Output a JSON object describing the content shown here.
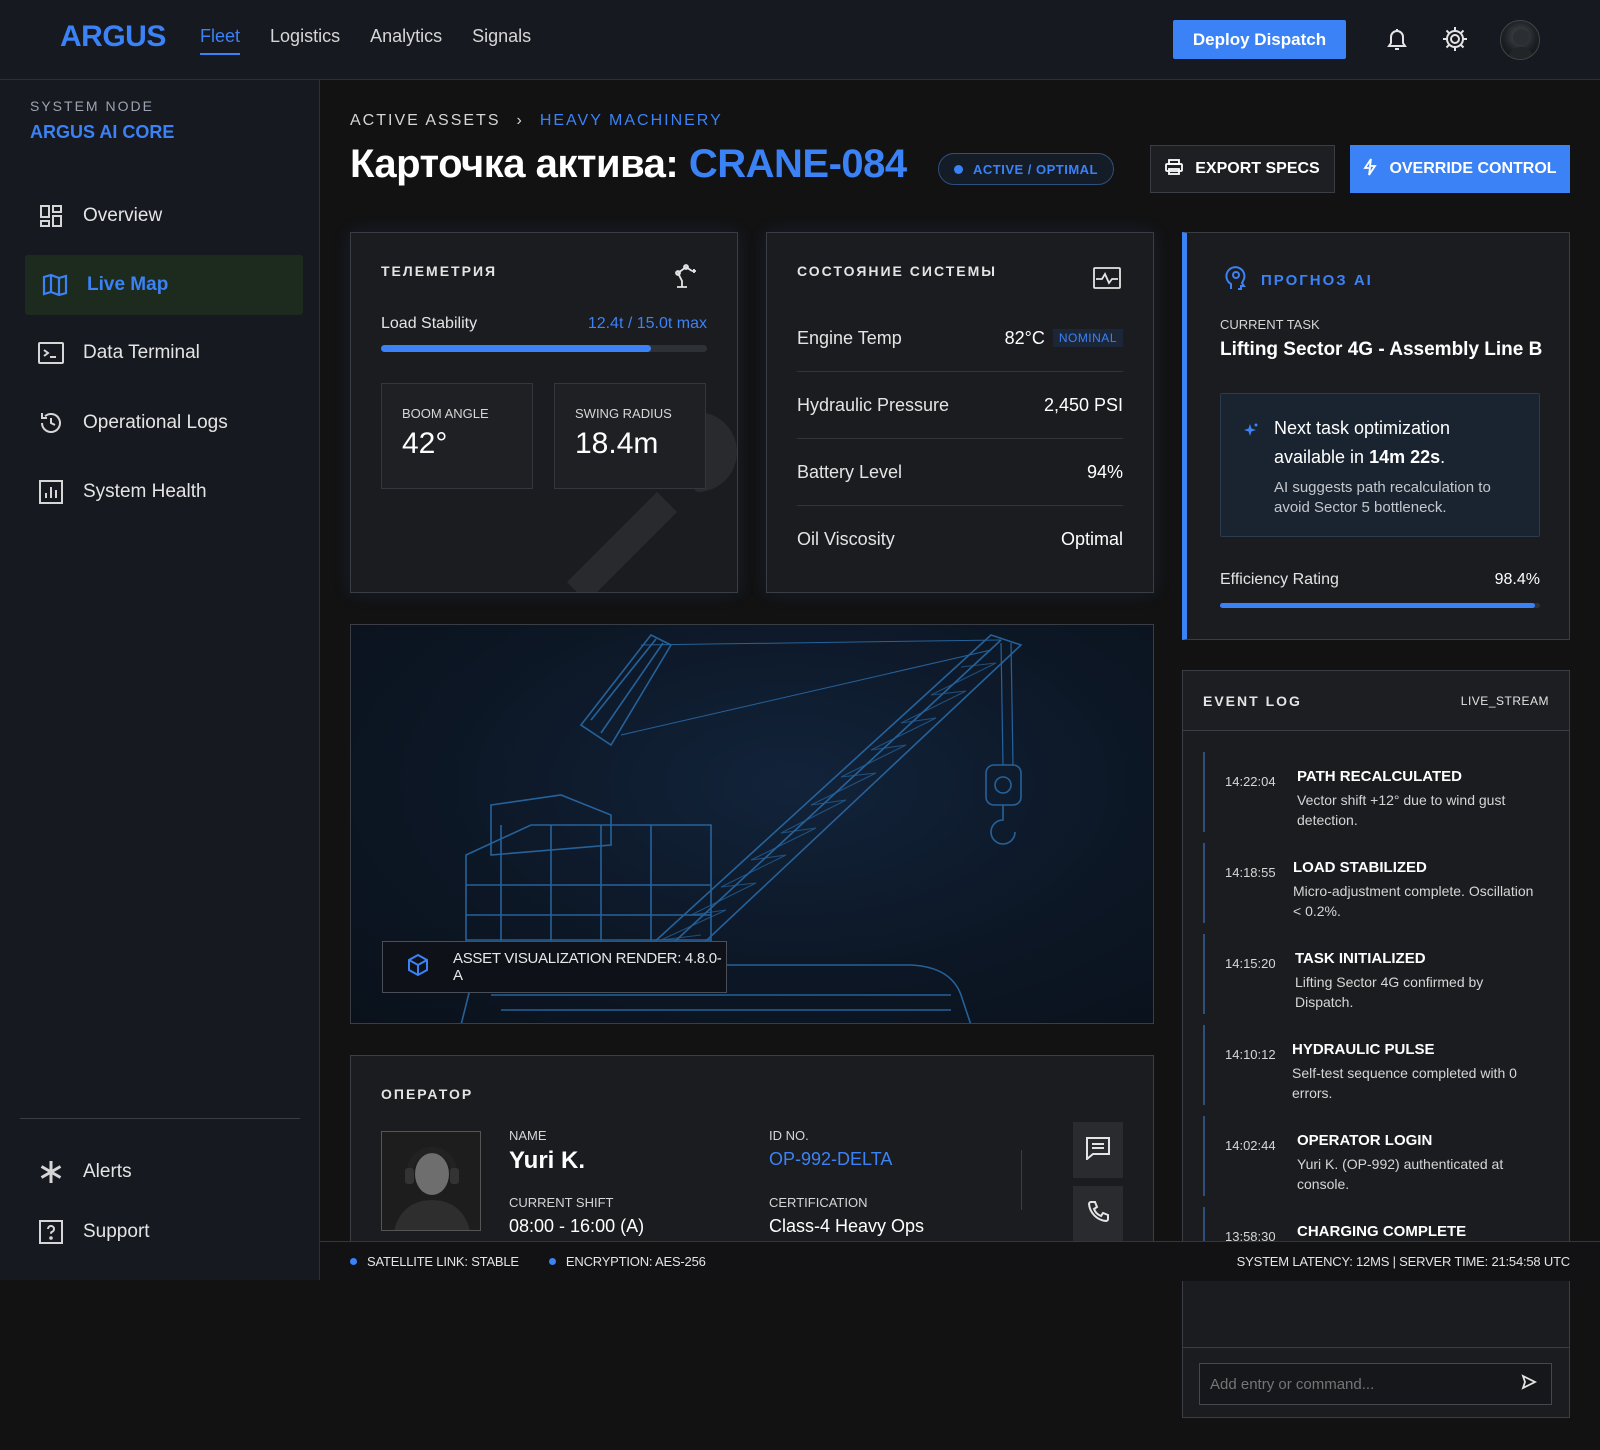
{
  "app": {
    "logo": "ARGUS"
  },
  "nav": {
    "links": [
      "Fleet",
      "Logistics",
      "Analytics",
      "Signals"
    ],
    "active": "Fleet",
    "deploy_label": "Deploy Dispatch",
    "icons": [
      "bell-icon",
      "gear-icon"
    ]
  },
  "sidebar": {
    "node_label": "SYSTEM NODE",
    "node_name": "ARGUS AI CORE",
    "items": [
      {
        "label": "Overview",
        "icon": "grid-icon"
      },
      {
        "label": "Live Map",
        "icon": "map-icon",
        "active": true
      },
      {
        "label": "Data Terminal",
        "icon": "terminal-icon"
      },
      {
        "label": "Operational Logs",
        "icon": "history-icon"
      },
      {
        "label": "System Health",
        "icon": "chart-icon"
      }
    ],
    "bottom": [
      {
        "label": "Alerts",
        "icon": "asterisk-icon"
      },
      {
        "label": "Support",
        "icon": "help-icon"
      }
    ]
  },
  "header": {
    "breadcrumb": [
      "ACTIVE ASSETS",
      "HEAVY MACHINERY"
    ],
    "title_prefix": "Карточка актива:",
    "asset_code": "CRANE-084",
    "status": "ACTIVE / OPTIMAL",
    "export_label": "EXPORT SPECS",
    "override_label": "OVERRIDE CONTROL"
  },
  "telemetry": {
    "title": "ТЕЛЕМЕТРИЯ",
    "load_label": "Load Stability",
    "load_value": "12.4t / 15.0t max",
    "load_fraction": 0.827,
    "boom_label": "BOOM ANGLE",
    "boom_value": "42°",
    "swing_label": "SWING RADIUS",
    "swing_value": "18.4m"
  },
  "system_state": {
    "title": "СОСТОЯНИЕ СИСТЕМЫ",
    "rows": [
      {
        "label": "Engine Temp",
        "value": "82°C",
        "badge": "NOMINAL"
      },
      {
        "label": "Hydraulic Pressure",
        "value": "2,450 PSI"
      },
      {
        "label": "Battery Level",
        "value": "94%"
      },
      {
        "label": "Oil Viscosity",
        "value": "Optimal"
      }
    ]
  },
  "ai": {
    "title": "ПРОГНОЗ AI",
    "current_task_label": "CURRENT TASK",
    "current_task": "Lifting Sector 4G - Assembly Line B",
    "next_text": "Next task optimization available in",
    "next_time": "14m 22s",
    "suggestion": "AI suggests path recalculation to avoid Sector 5 bottleneck.",
    "efficiency_label": "Efficiency Rating",
    "efficiency_value": "98.4%",
    "efficiency_fraction": 0.984
  },
  "render": {
    "label": "ASSET VISUALIZATION RENDER: 4.8.0-A"
  },
  "operator": {
    "title": "ОПЕРАТОР",
    "name_label": "NAME",
    "name": "Yuri K.",
    "id_label": "ID NO.",
    "id": "OP-992-DELTA",
    "shift_label": "CURRENT SHIFT",
    "shift": "08:00 - 16:00 (A)",
    "cert_label": "CERTIFICATION",
    "cert": "Class-4 Heavy Ops"
  },
  "event_log": {
    "title": "EVENT LOG",
    "stream": "LIVE_STREAM",
    "events": [
      {
        "time": "14:22:04",
        "title": "PATH RECALCULATED",
        "desc": "Vector shift +12° due to wind gust detection."
      },
      {
        "time": "14:18:55",
        "title": "LOAD STABILIZED",
        "desc": "Micro-adjustment complete. Oscillation < 0.2%."
      },
      {
        "time": "14:15:20",
        "title": "TASK INITIALIZED",
        "desc": "Lifting Sector 4G confirmed by Dispatch."
      },
      {
        "time": "14:10:12",
        "title": "HYDRAULIC PULSE",
        "desc": "Self-test sequence completed with 0 errors."
      },
      {
        "time": "14:02:44",
        "title": "OPERATOR LOGIN",
        "desc": "Yuri K. (OP-992) authenticated at console."
      },
      {
        "time": "13:58:30",
        "title": "CHARGING COMPLETE",
        "desc": ""
      }
    ],
    "input_placeholder": "Add entry or command..."
  },
  "statusbar": {
    "satellite": "SATELLITE LINK: STABLE",
    "encryption": "ENCRYPTION: AES-256",
    "right": "SYSTEM LATENCY: 12MS | SERVER TIME: 21:54:58 UTC"
  },
  "colors": {
    "accent": "#3b82f6",
    "background": "#121212",
    "panel": "#1b1c1f"
  }
}
